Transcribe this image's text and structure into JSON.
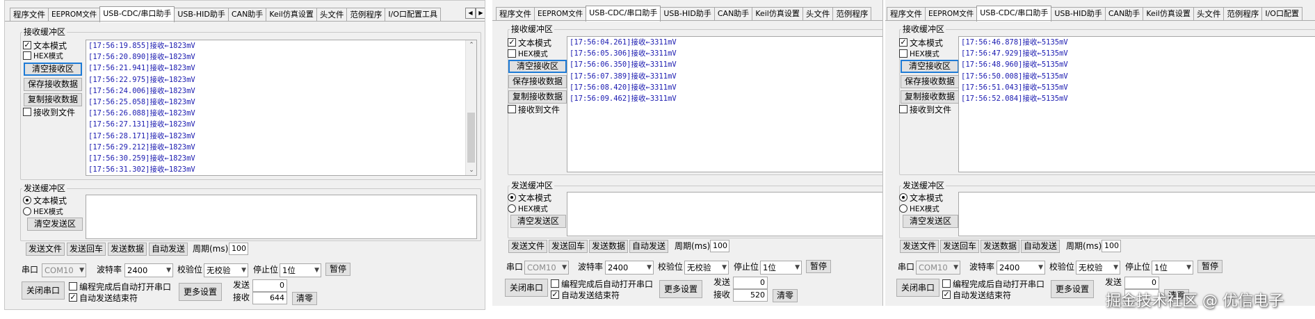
{
  "tabs": [
    "程序文件",
    "EEPROM文件",
    "USB-CDC/串口助手",
    "USB-HID助手",
    "CAN助手",
    "Keil仿真设置",
    "头文件",
    "范例程序",
    "I/O口配置工具"
  ],
  "tabs_tail": [
    "程序文件",
    "EEPROM文件",
    "USB-CDC/串口助手",
    "USB-HID助手",
    "CAN助手",
    "Keil仿真设置",
    "头文件",
    "范例程序",
    "I/O口配置"
  ],
  "recv_group": "接收缓冲区",
  "send_group": "发送缓冲区",
  "text_mode": "文本模式",
  "hex_mode": "HEX模式",
  "clear_recv": "清空接收区",
  "save_recv": "保存接收数据",
  "copy_recv": "复制接收数据",
  "recv_to_file": "接收到文件",
  "clear_send": "清空发送区",
  "send_file": "发送文件",
  "send_enter": "发送回车",
  "send_data": "发送数据",
  "auto_send": "自动发送",
  "period_label": "周期(ms)",
  "period_value": "100",
  "port_label": "串口",
  "port_value": "COM10",
  "baud_label": "波特率",
  "baud_value": "2400",
  "parity_label": "校验位",
  "parity_value": "无校验",
  "stop_label": "停止位",
  "stop_value": "1位",
  "pause": "暂停",
  "close_port": "关闭串口",
  "auto_open": "编程完成后自动打开串口",
  "auto_end": "自动发送结束符",
  "more_settings": "更多设置",
  "send_count_label": "发送",
  "recv_count_label": "接收",
  "clear_count": "清零",
  "panels": [
    {
      "send_count": "0",
      "recv_count": "644",
      "recv_lines": [
        "[17:56:19.855]接收←1823mV",
        "[17:56:20.890]接收←1823mV",
        "[17:56:21.941]接收←1823mV",
        "[17:56:22.975]接收←1823mV",
        "[17:56:24.006]接收←1823mV",
        "[17:56:25.058]接收←1823mV",
        "[17:56:26.088]接收←1823mV",
        "[17:56:27.131]接收←1823mV",
        "[17:56:28.171]接收←1823mV",
        "[17:56:29.212]接收←1823mV",
        "[17:56:30.259]接收←1823mV",
        "[17:56:31.302]接收←1823mV"
      ]
    },
    {
      "send_count": "0",
      "recv_count": "520",
      "recv_lines": [
        "[17:56:04.261]接收←3311mV",
        "[17:56:05.306]接收←3311mV",
        "[17:56:06.350]接收←3311mV",
        "[17:56:07.389]接收←3311mV",
        "[17:56:08.420]接收←3311mV",
        "[17:56:09.462]接收←3311mV"
      ]
    },
    {
      "send_count": "0",
      "recv_count": "",
      "recv_lines": [
        "[17:56:46.878]接收←5135mV",
        "[17:56:47.929]接收←5135mV",
        "[17:56:48.960]接收←5135mV",
        "[17:56:50.008]接收←5135mV",
        "[17:56:51.043]接收←5135mV",
        "[17:56:52.084]接收←5135mV"
      ]
    }
  ],
  "watermark": "掘金技术社区 @ 优信电子"
}
